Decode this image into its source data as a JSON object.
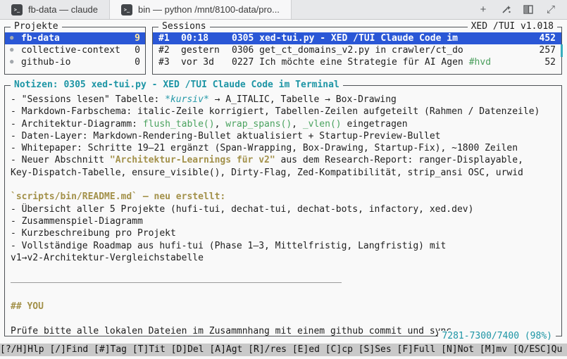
{
  "window": {
    "tabs": [
      {
        "label": "fb-data — claude"
      },
      {
        "label": "bin — python /mnt/8100-data/pro..."
      }
    ]
  },
  "projects_panel": {
    "title": "Projekte",
    "items": [
      {
        "name": "fb-data",
        "count": "9"
      },
      {
        "name": "collective-context",
        "count": "0"
      },
      {
        "name": "github-io",
        "count": "0"
      }
    ]
  },
  "sessions_panel": {
    "title": "Sessions",
    "version": "XED /TUI v1.018",
    "rows": [
      {
        "num": "#1",
        "time": "00:18",
        "text": "0305 xed-tui.py - XED /TUI Claude Code im",
        "tag": "",
        "count": "452"
      },
      {
        "num": "#2",
        "time": "gestern",
        "text": "0306 get_ct_domains_v2.py in crawler/ct_do",
        "tag": "",
        "count": "257"
      },
      {
        "num": "#3",
        "time": "vor 3d",
        "text": "0227 Ich möchte eine Strategie für AI Agen",
        "tag": "#hvd",
        "count": "52"
      }
    ]
  },
  "notes_panel": {
    "title": "Notizen: 0305 xed-tui.py - XED /TUI Claude Code im Terminal",
    "scroll_info": "7281-7300/7400 (98%)",
    "lines": [
      [
        {
          "t": "- \"Sessions lesen\" Tabelle: "
        },
        {
          "t": "*kursiv*",
          "s": "teal-italic"
        },
        {
          "t": " → A_ITALIC, Tabelle → Box-Drawing"
        }
      ],
      [
        {
          "t": "- Markdown-Farbschema: italic-Zeile korrigiert, Tabellen-Zeilen aufgeteilt (Rahmen / Datenzeile)"
        }
      ],
      [
        {
          "t": "- Architektur-Diagramm: "
        },
        {
          "t": "flush_table()",
          "s": "green"
        },
        {
          "t": ", "
        },
        {
          "t": "wrap_spans()",
          "s": "green"
        },
        {
          "t": ", "
        },
        {
          "t": "_vlen()",
          "s": "green"
        },
        {
          "t": " eingetragen"
        }
      ],
      [
        {
          "t": "- Daten-Layer: Markdown-Rendering-Bullet aktualisiert + Startup-Preview-Bullet"
        }
      ],
      [
        {
          "t": "- Whitepaper: Schritte 19–21 ergänzt (Span-Wrapping, Box-Drawing, Startup-Fix), ~1800 Zeilen"
        }
      ],
      [
        {
          "t": "- Neuer Abschnitt "
        },
        {
          "t": "\"Architektur-Learnings für v2\"",
          "s": "gold"
        },
        {
          "t": " aus dem Research-Report: ranger-Displayable,"
        }
      ],
      [
        {
          "t": "Key-Dispatch-Tabelle, ensure_visible(), Dirty-Flag, Zed-Kompatibilität, strip_ansi OSC, urwid"
        }
      ],
      [
        {
          "t": ""
        }
      ],
      [
        {
          "t": "`scripts/bin/README.md` — neu erstellt:",
          "s": "gold"
        }
      ],
      [
        {
          "t": "- Übersicht aller 5 Projekte (hufi-tui, dechat-tui, dechat-bots, infactory, xed.dev)"
        }
      ],
      [
        {
          "t": "- Zusammenspiel-Diagramm"
        }
      ],
      [
        {
          "t": "- Kurzbeschreibung pro Projekt"
        }
      ],
      [
        {
          "t": "- Vollständige Roadmap aus hufi-tui (Phase 1–3, Mittelfristig, Langfristig) mit"
        }
      ],
      [
        {
          "t": "v1→v2-Architektur-Vergleichstabelle"
        }
      ],
      [
        {
          "t": ""
        }
      ],
      [
        {
          "hr": true
        }
      ],
      [
        {
          "t": ""
        }
      ],
      [
        {
          "t": "## YOU",
          "s": "gold"
        }
      ],
      [
        {
          "t": ""
        }
      ],
      [
        {
          "t": "Prüfe bitte alle lokalen Dateien im Zusammnhang mit einem github commit und sync"
        }
      ]
    ]
  },
  "status_bar": {
    "text": "[?/H]Hlp [/]Find [#]Tag [T]Tit [D]Del [A]Agt [R]/res [E]ed [C]cp [S]Ses [F]Full [N]Not [M]mv [Q/ESC]Qu"
  },
  "colors": {
    "selection_blue": "#2a57d6",
    "teal": "#1d95a5",
    "green": "#49a25e",
    "gold": "#a3914a",
    "statusbar_bg": "#c9c9c9"
  }
}
